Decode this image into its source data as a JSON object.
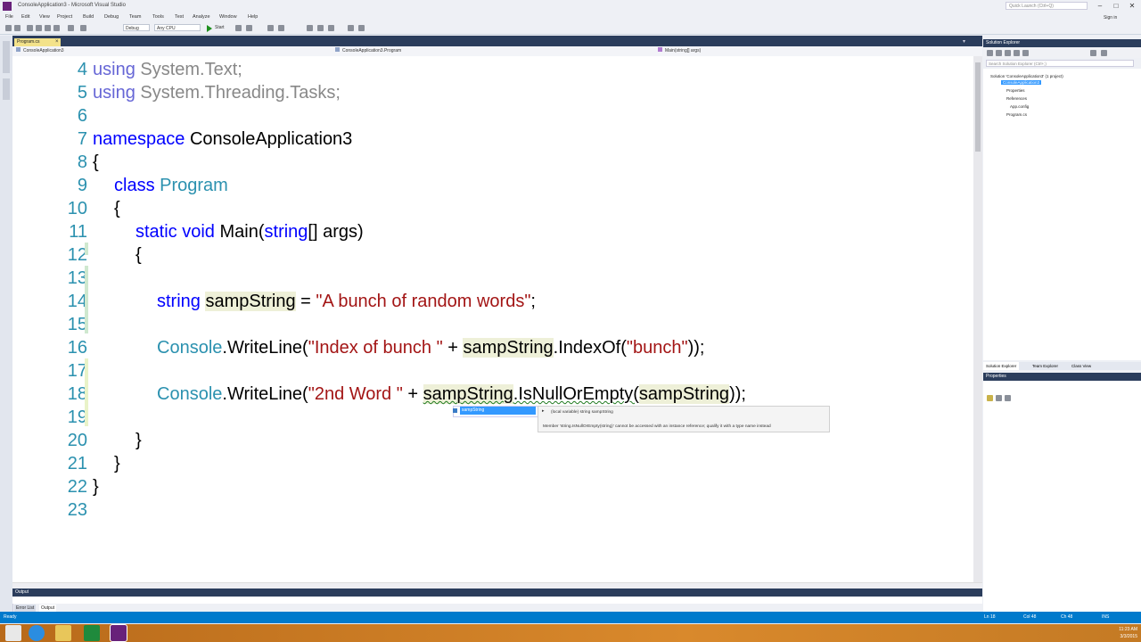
{
  "window": {
    "title": "ConsoleApplication3 - Microsoft Visual Studio",
    "quick_launch_placeholder": "Quick Launch (Ctrl+Q)",
    "sign_in": "Sign in"
  },
  "menu": [
    "File",
    "Edit",
    "View",
    "Project",
    "Build",
    "Debug",
    "Team",
    "Tools",
    "Test",
    "Analyze",
    "Window",
    "Help"
  ],
  "toolbar": {
    "config": "Debug",
    "platform": "Any CPU",
    "start": "Start"
  },
  "doc_tab": {
    "label": "Program.cs",
    "close": "×"
  },
  "navbar": {
    "project": "ConsoleApplication3",
    "class": "ConsoleApplication3.Program",
    "member": "Main(string[] args)"
  },
  "code_lines": [
    {
      "n": "4",
      "t": "using System.Text;"
    },
    {
      "n": "5",
      "t": "using System.Threading.Tasks;"
    },
    {
      "n": "6",
      "t": ""
    },
    {
      "n": "7",
      "t": "namespace ConsoleApplication3"
    },
    {
      "n": "8",
      "t": "{"
    },
    {
      "n": "9",
      "t": "class Program"
    },
    {
      "n": "10",
      "t": "{"
    },
    {
      "n": "11",
      "t": "static void Main(string[] args)"
    },
    {
      "n": "12",
      "t": "{"
    },
    {
      "n": "13",
      "t": ""
    },
    {
      "n": "14",
      "t": "string sampString = \"A bunch of random words\";"
    },
    {
      "n": "15",
      "t": ""
    },
    {
      "n": "16",
      "t": "Console.WriteLine(\"Index of bunch \" + sampString.IndexOf(\"bunch\"));"
    },
    {
      "n": "17",
      "t": ""
    },
    {
      "n": "18",
      "t": "Console.WriteLine(\"2nd Word \" + sampString.IsNullOrEmpty(sampString));"
    },
    {
      "n": "19",
      "t": ""
    },
    {
      "n": "20",
      "t": "}"
    },
    {
      "n": "21",
      "t": "}"
    },
    {
      "n": "22",
      "t": "}"
    },
    {
      "n": "23",
      "t": ""
    }
  ],
  "tokens": {
    "using": "using",
    "ns1": " System.Text;",
    "ns2": " System.Threading.Tasks;",
    "namespace": "namespace",
    "nsname": " ConsoleApplication3",
    "class": "class",
    "classname": " Program",
    "static": "static",
    "void": " void",
    "main": " Main(",
    "string": "string",
    "args": "[] args)",
    "l14_type": "string",
    "l14_var": "sampString",
    "l14_eq": " = ",
    "l14_str": "\"A bunch of random words\"",
    "l14_end": ";",
    "console": "Console",
    "writeline": ".WriteLine(",
    "l16_str": "\"Index of bunch \"",
    "l16_plus": " + ",
    "l16_var": "sampString",
    "l16_call": ".IndexOf(",
    "l16_arg": "\"bunch\"",
    "l16_end": "));",
    "l18_str": "\"2nd Word \"",
    "l18_plus": " + ",
    "l18_var": "sampString",
    "l18_call": ".IsNullOrEmpty(",
    "l18_arg": "sampString",
    "l18_end": "));",
    "open": "{",
    "close": "}"
  },
  "intellisense": {
    "selected": "sampString",
    "tooltip_line1": "(local variable) string sampString",
    "tooltip_line2": "Member 'string.IsNullOrEmpty(string)' cannot be accessed with an instance reference; qualify it with a type name instead"
  },
  "output_panel": {
    "title": "Output",
    "tabs": [
      "Error List",
      "Output"
    ]
  },
  "solution_explorer": {
    "title": "Solution Explorer",
    "search_placeholder": "Search Solution Explorer (Ctrl+;)",
    "items": [
      {
        "label": "Solution 'ConsoleApplication3' (1 project)"
      },
      {
        "label": "ConsoleApplication3"
      },
      {
        "label": "Properties"
      },
      {
        "label": "References"
      },
      {
        "label": "App.config"
      },
      {
        "label": "Program.cs"
      }
    ],
    "tabs": [
      "Solution Explorer",
      "Team Explorer",
      "Class View"
    ]
  },
  "properties": {
    "title": "Properties"
  },
  "statusbar": {
    "left": "Ready",
    "ln": "Ln 18",
    "col": "Col 48",
    "ch": "Ch 48",
    "mode": "INS"
  },
  "clock": {
    "time": "11:23 AM",
    "date": "3/3/2015"
  },
  "colors": {
    "vs_accent": "#007acc",
    "vs_purple": "#68217a",
    "keyword": "#0000ff",
    "type": "#2b91af",
    "string": "#a31515"
  }
}
